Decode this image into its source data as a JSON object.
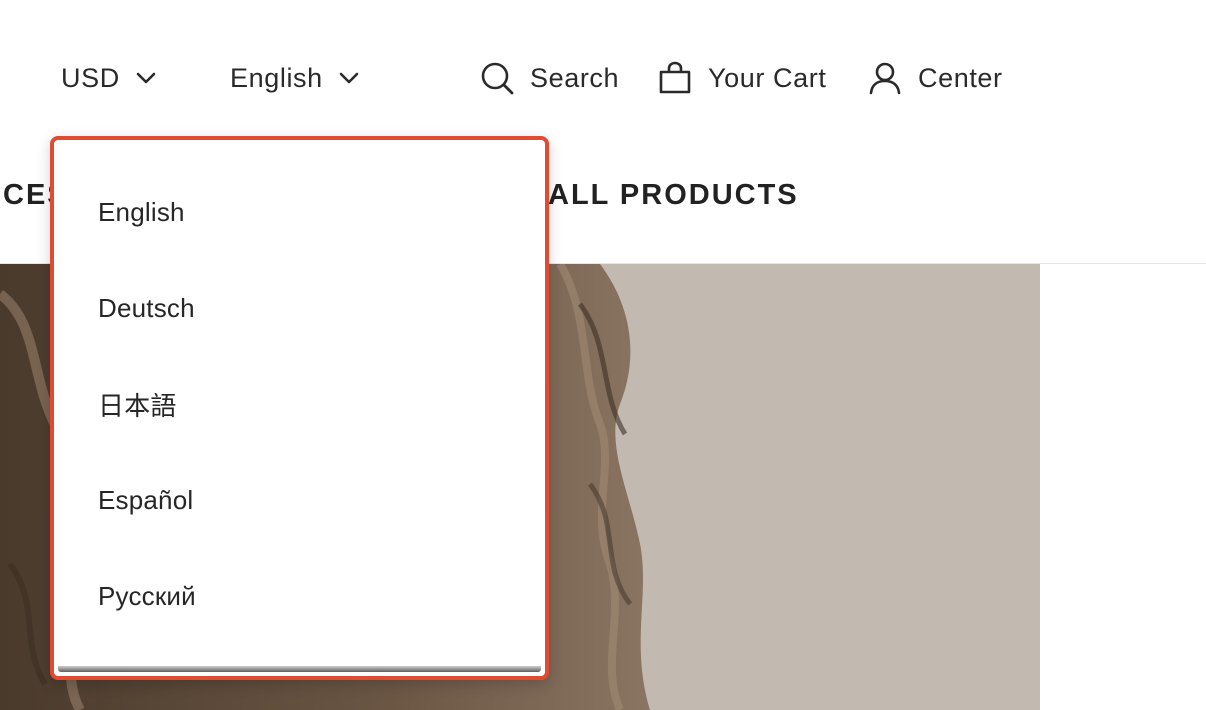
{
  "header": {
    "currency": {
      "label": "USD",
      "icon": "chevron-down-icon"
    },
    "language": {
      "label": "English",
      "icon": "chevron-down-icon"
    },
    "search": {
      "label": "Search",
      "icon": "search-icon"
    },
    "cart": {
      "label": "Your Cart",
      "icon": "shopping-bag-icon"
    },
    "account": {
      "label": "Center",
      "icon": "user-icon"
    }
  },
  "nav": {
    "items": [
      {
        "label": "CES"
      },
      {
        "label": "ALL PRODUCTS"
      }
    ]
  },
  "language_dropdown": {
    "accent_color": "#e04b32",
    "options": [
      {
        "label": "English"
      },
      {
        "label": "Deutsch"
      },
      {
        "label": "日本語"
      },
      {
        "label": "Español"
      },
      {
        "label": "Русский"
      }
    ]
  }
}
